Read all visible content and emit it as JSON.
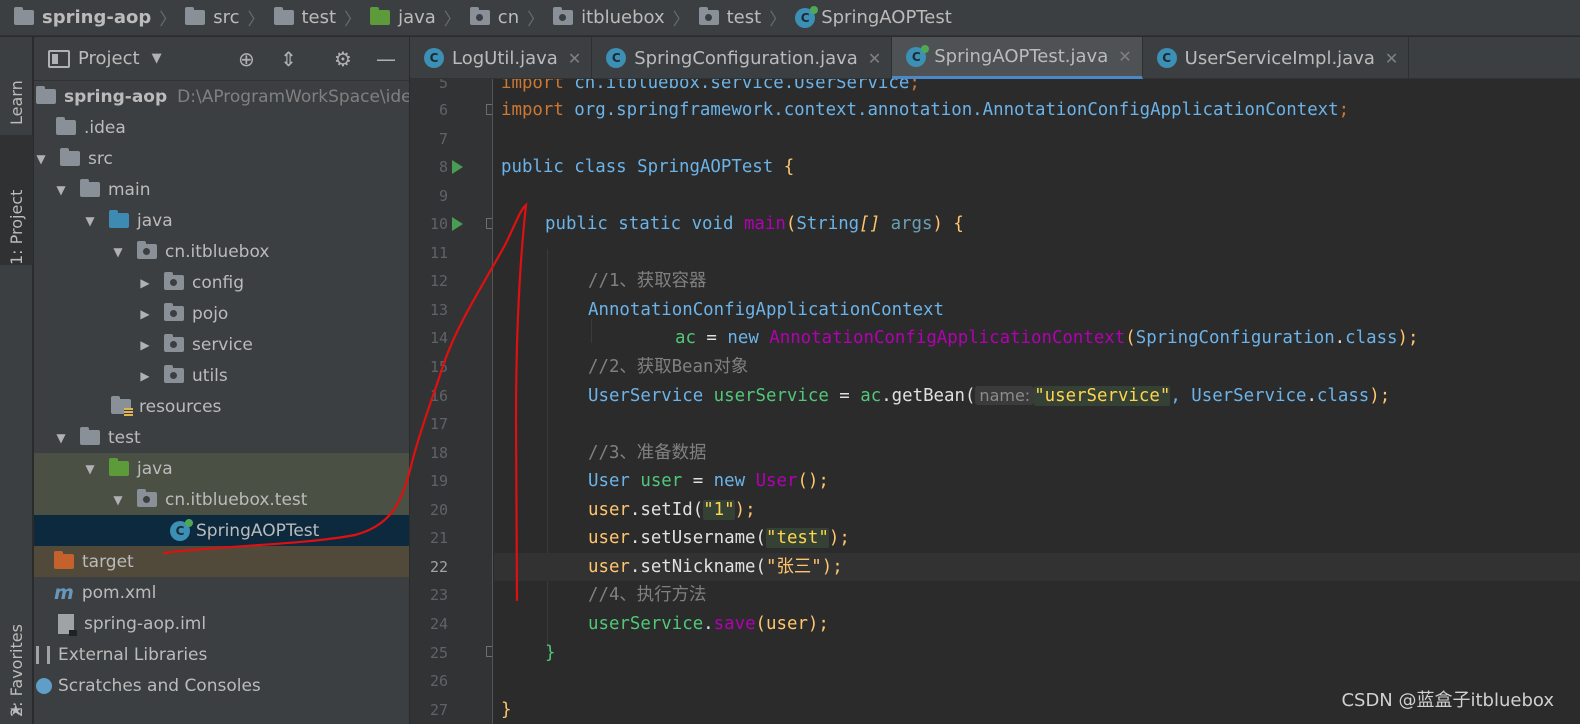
{
  "breadcrumb": [
    {
      "label": "spring-aop",
      "icon": "module-folder-icon"
    },
    {
      "label": "src",
      "icon": "folder-icon"
    },
    {
      "label": "test",
      "icon": "folder-icon"
    },
    {
      "label": "java",
      "icon": "test-root-folder-icon"
    },
    {
      "label": "cn",
      "icon": "package-icon"
    },
    {
      "label": "itbluebox",
      "icon": "package-icon"
    },
    {
      "label": "test",
      "icon": "package-icon"
    },
    {
      "label": "SpringAOPTest",
      "icon": "test-class-icon"
    }
  ],
  "left_strip": {
    "learn": "Learn",
    "project": "1: Project",
    "favorites": "2: Favorites"
  },
  "project_panel": {
    "title": "Project",
    "tree": [
      {
        "label": "spring-aop",
        "hint": "D:\\AProgramWorkSpace\\idea\\sp",
        "bold": true
      },
      {
        "label": ".idea"
      },
      {
        "label": "src"
      },
      {
        "label": "main"
      },
      {
        "label": "java"
      },
      {
        "label": "cn.itbluebox"
      },
      {
        "label": "config"
      },
      {
        "label": "pojo"
      },
      {
        "label": "service"
      },
      {
        "label": "utils"
      },
      {
        "label": "resources"
      },
      {
        "label": "test"
      },
      {
        "label": "java"
      },
      {
        "label": "cn.itbluebox.test"
      },
      {
        "label": "SpringAOPTest"
      },
      {
        "label": "target"
      },
      {
        "label": "pom.xml"
      },
      {
        "label": "spring-aop.iml"
      },
      {
        "label": "External Libraries"
      },
      {
        "label": "Scratches and Consoles"
      }
    ]
  },
  "editor_tabs": [
    {
      "label": "LogUtil.java",
      "active": false
    },
    {
      "label": "SpringConfiguration.java",
      "active": false
    },
    {
      "label": "SpringAOPTest.java",
      "active": true
    },
    {
      "label": "UserServiceImpl.java",
      "active": false
    }
  ],
  "code": {
    "line_numbers": [
      "5",
      "6",
      "7",
      "8",
      "9",
      "10",
      "11",
      "12",
      "13",
      "14",
      "15",
      "16",
      "17",
      "18",
      "19",
      "20",
      "21",
      "22",
      "23",
      "24",
      "25",
      "26",
      "27"
    ],
    "current_line": "22",
    "parameter_hint": "name:",
    "lines": {
      "l5a": "import ",
      "l5b": "cn.itbluebox.service.UserService",
      "l5c": ";",
      "l6a": "import ",
      "l6b": "org.springframework.context.annotation.AnnotationConfigApplicationContext",
      "l6c": ";",
      "l8a": "public class ",
      "l8b": "SpringAOPTest",
      "l8c": " {",
      "l10a": "public static void ",
      "l10b": "main",
      "l10c": "(",
      "l10d": "String",
      "l10e": "[]",
      "l10f": " args",
      "l10g": ") {",
      "l12": "//1、获取容器",
      "l13": "AnnotationConfigApplicationContext",
      "l14a": "ac",
      "l14b": " = ",
      "l14c": "new ",
      "l14d": "AnnotationConfigApplicationContext",
      "l14e": "(",
      "l14f": "SpringConfiguration",
      "l14g": ".",
      "l14h": "class",
      "l14i": ");",
      "l15": "//2、获取Bean对象",
      "l16a": "UserService",
      "l16b": " userService",
      "l16c": " = ",
      "l16d": "ac",
      "l16e": ".getBean(",
      "l16f": "\"userService\"",
      "l16g": ", ",
      "l16h": "UserService",
      "l16i": ".",
      "l16j": "class",
      "l16k": ");",
      "l18": "//3、准备数据",
      "l19a": "User",
      "l19b": " user",
      "l19c": " = ",
      "l19d": "new ",
      "l19e": "User",
      "l19f": "();",
      "l20a": "user",
      "l20b": ".setId(",
      "l20c": "\"1\"",
      "l20d": ");",
      "l21a": "user",
      "l21b": ".setUsername(",
      "l21c": "\"test\"",
      "l21d": ");",
      "l22a": "user",
      "l22b": ".setNickname(",
      "l22c": "\"张三\"",
      "l22d": ");",
      "l23": "//4、执行方法",
      "l24a": "userService",
      "l24b": ".",
      "l24c": "save",
      "l24d": "(",
      "l24e": "user",
      "l24f": ");",
      "l25": "}",
      "l27": "}"
    }
  },
  "watermark": "CSDN @蓝盒子itbluebox",
  "colors": {
    "annotation_stroke": "#e01010",
    "accent": "#4a88c7"
  }
}
